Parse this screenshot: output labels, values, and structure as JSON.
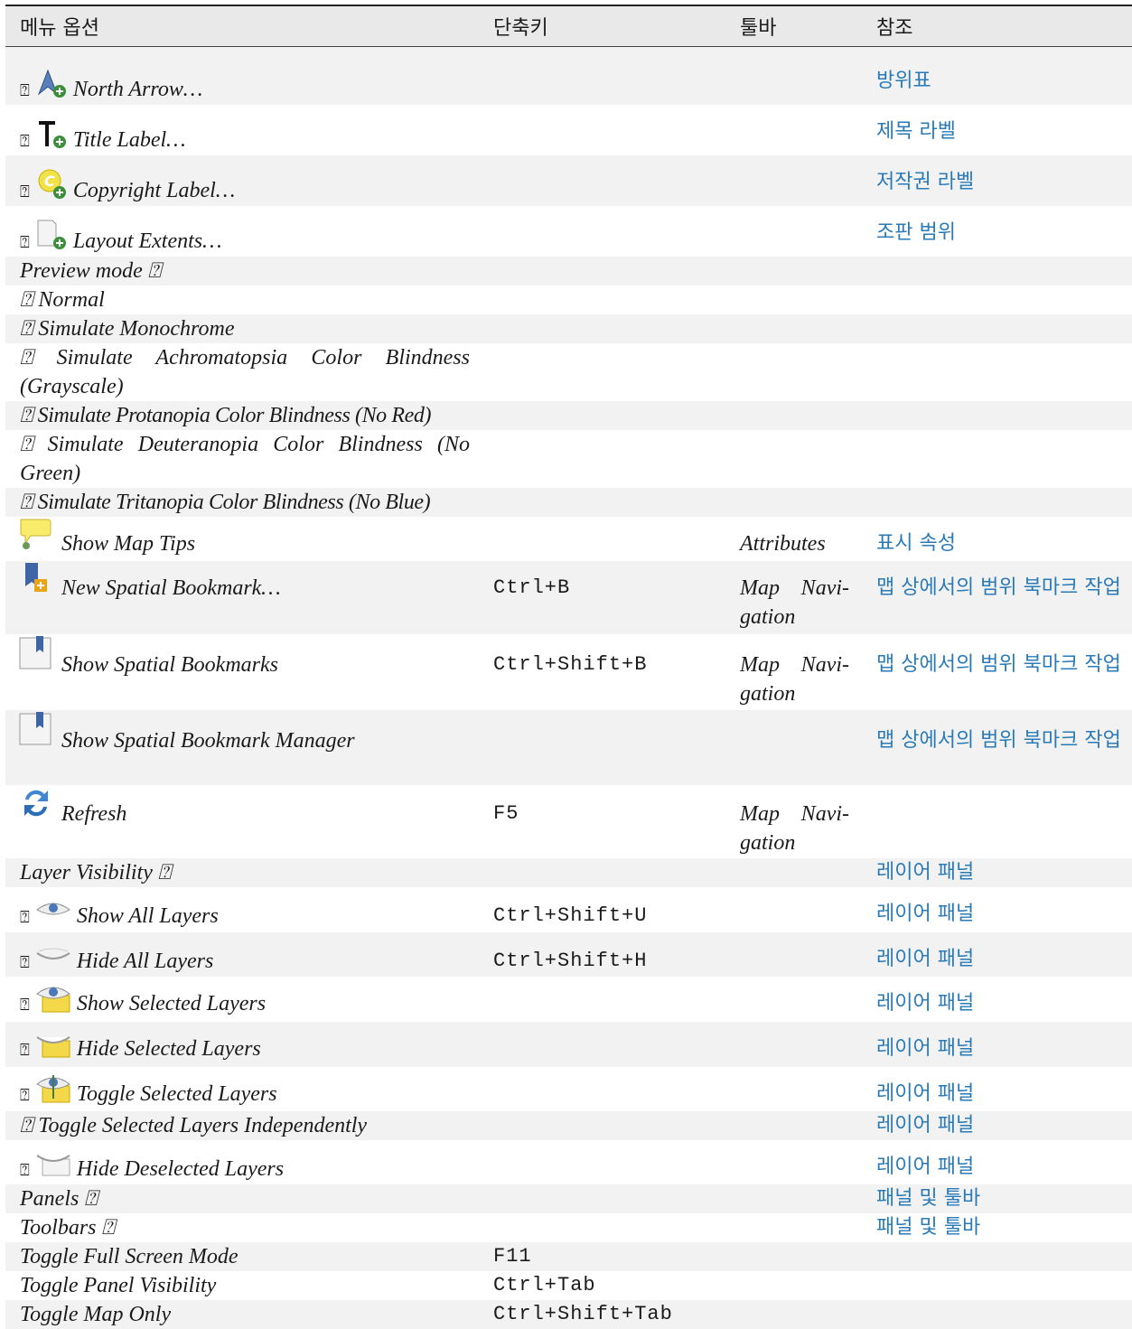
{
  "headers": [
    "메뉴 옵션",
    "단축키",
    "툴바",
    "참조"
  ],
  "rows": [
    {
      "glyph": "⍰",
      "label": "North Arrow…",
      "shortcut": "",
      "toolbar": "",
      "ref": "방위표"
    },
    {
      "glyph": "⍰",
      "label": "Title Label…",
      "shortcut": "",
      "toolbar": "",
      "ref": "제목 라벨"
    },
    {
      "glyph": "⍰",
      "label": "Copyright Label…",
      "shortcut": "",
      "toolbar": "",
      "ref": "저작권 라벨"
    },
    {
      "glyph": "⍰",
      "label": "Layout Extents…",
      "shortcut": "",
      "toolbar": "",
      "ref": "조판 범위"
    },
    {
      "label": "Preview mode ⍰",
      "shortcut": "",
      "toolbar": "",
      "ref": ""
    },
    {
      "label": "⍰ Normal",
      "shortcut": "",
      "toolbar": "",
      "ref": ""
    },
    {
      "label": "⍰ Simulate Monochrome",
      "shortcut": "",
      "toolbar": "",
      "ref": ""
    },
    {
      "label": "⍰ Simulate Achromatopsia Color Blindness (Grayscale)",
      "shortcut": "",
      "toolbar": "",
      "ref": ""
    },
    {
      "label": "⍰ Simulate Protanopia Color Blindness (No Red)",
      "shortcut": "",
      "toolbar": "",
      "ref": ""
    },
    {
      "label": "⍰ Simulate Deuteranopia Color Blindness (No Green)",
      "shortcut": "",
      "toolbar": "",
      "ref": ""
    },
    {
      "label": "⍰ Simulate Tritanopia Color Blindness (No Blue)",
      "shortcut": "",
      "toolbar": "",
      "ref": ""
    },
    {
      "label": "Show Map Tips",
      "shortcut": "",
      "toolbar": "Attributes",
      "ref": "표시 속성"
    },
    {
      "label": "New Spatial Bookmark…",
      "shortcut": "Ctrl+B",
      "toolbar": "Map Navi-gation",
      "ref": "맵 상에서의 범위 북마크 작업"
    },
    {
      "label": "Show Spatial Bookmarks",
      "shortcut": "Ctrl+Shift+B",
      "toolbar": "Map Navi-gation",
      "ref": "맵 상에서의 범위 북마크 작업"
    },
    {
      "label": "Show Spatial Bookmark Manager",
      "shortcut": "",
      "toolbar": "",
      "ref": "맵 상에서의 범위 북마크 작업"
    },
    {
      "label": "Refresh",
      "shortcut": "F5",
      "toolbar": "Map Navi-gation",
      "ref": ""
    },
    {
      "label": "Layer Visibility ⍰",
      "shortcut": "",
      "toolbar": "",
      "ref": "레이어 패널"
    },
    {
      "glyph": "⍰",
      "label": "Show All Layers",
      "shortcut": "Ctrl+Shift+U",
      "toolbar": "",
      "ref": "레이어 패널"
    },
    {
      "glyph": "⍰",
      "label": "Hide All Layers",
      "shortcut": "Ctrl+Shift+H",
      "toolbar": "",
      "ref": "레이어 패널"
    },
    {
      "glyph": "⍰",
      "label": "Show Selected Layers",
      "shortcut": "",
      "toolbar": "",
      "ref": "레이어 패널"
    },
    {
      "glyph": "⍰",
      "label": "Hide Selected Layers",
      "shortcut": "",
      "toolbar": "",
      "ref": "레이어 패널"
    },
    {
      "glyph": "⍰",
      "label": "Toggle Selected Layers",
      "shortcut": "",
      "toolbar": "",
      "ref": "레이어 패널"
    },
    {
      "label": "⍰ Toggle Selected Layers Independently",
      "shortcut": "",
      "toolbar": "",
      "ref": "레이어 패널"
    },
    {
      "glyph": "⍰",
      "label": "Hide Deselected Layers",
      "shortcut": "",
      "toolbar": "",
      "ref": "레이어 패널"
    },
    {
      "label": "Panels ⍰",
      "shortcut": "",
      "toolbar": "",
      "ref": "패널 및 툴바"
    },
    {
      "label": "Toolbars ⍰",
      "shortcut": "",
      "toolbar": "",
      "ref": "패널 및 툴바"
    },
    {
      "label": "Toggle Full Screen Mode",
      "shortcut": "F11",
      "toolbar": "",
      "ref": ""
    },
    {
      "label": "Toggle Panel Visibility",
      "shortcut": "Ctrl+Tab",
      "toolbar": "",
      "ref": ""
    },
    {
      "label": "Toggle Map Only",
      "shortcut": "Ctrl+Shift+Tab",
      "toolbar": "",
      "ref": ""
    }
  ],
  "icons": [
    "north-arrow-add",
    "title-label-add",
    "copyright-label-add",
    "layout-extents-add",
    "map-tips",
    "new-bookmark",
    "show-bookmarks",
    "bookmark-manager",
    "refresh",
    "show-all-layers",
    "hide-all-layers",
    "show-selected-layers",
    "hide-selected-layers",
    "toggle-selected-layers",
    "hide-deselected-layers"
  ]
}
